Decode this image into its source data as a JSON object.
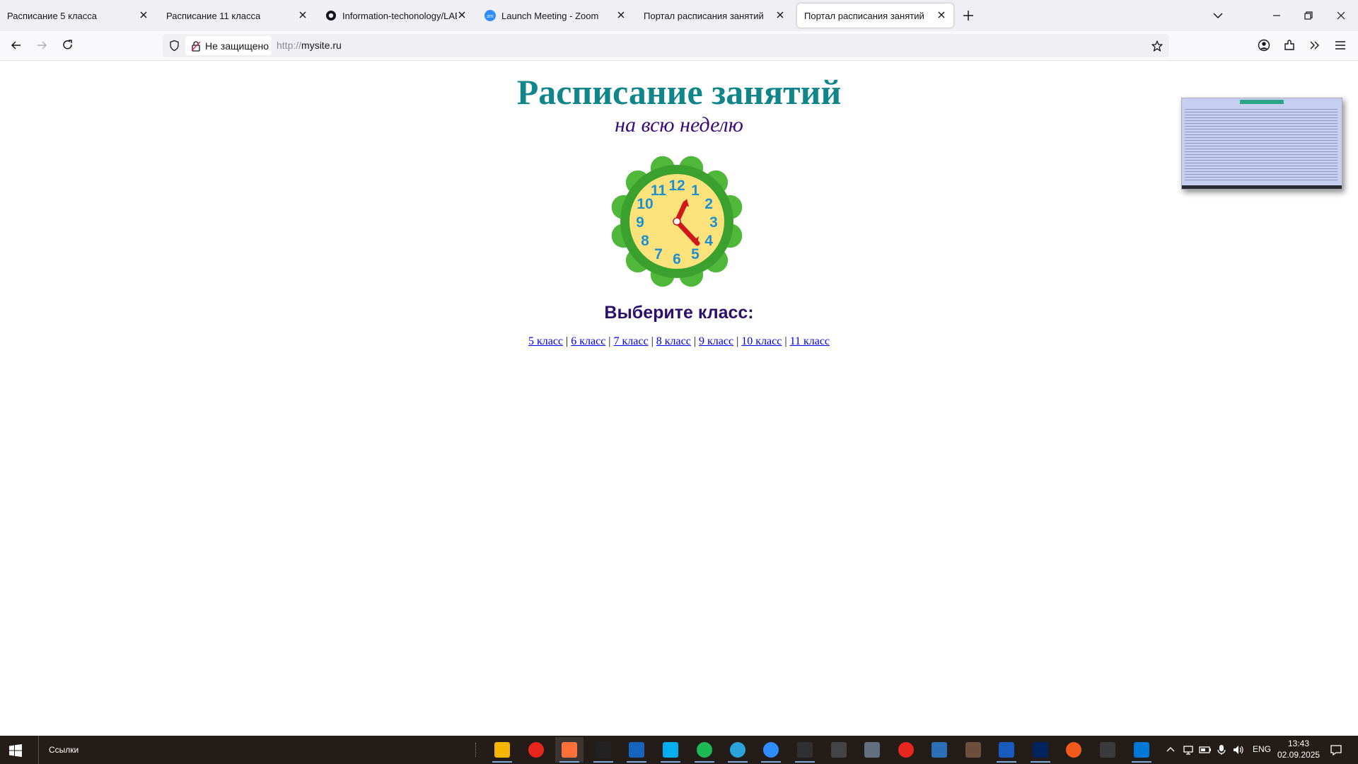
{
  "browser": {
    "tabs": [
      {
        "title": "Расписание 5 класса",
        "active": false,
        "favicon": "none"
      },
      {
        "title": "Расписание 11 класса",
        "active": false,
        "favicon": "none"
      },
      {
        "title": "Information-techonology/LAB1",
        "active": false,
        "favicon": "github-icon"
      },
      {
        "title": "Launch Meeting - Zoom",
        "active": false,
        "favicon": "zoom-icon"
      },
      {
        "title": "Портал расписания занятий",
        "active": false,
        "favicon": "none"
      },
      {
        "title": "Портал расписания занятий",
        "active": true,
        "favicon": "none"
      }
    ],
    "security_label": "Не защищено",
    "url_protocol": "http://",
    "url_host": "mysite.ru"
  },
  "page": {
    "title": "Расписание занятий",
    "subtitle": "на всю неделю",
    "choose_label": "Выберите класс:",
    "class_links": [
      "5 класс",
      "6 класс",
      "7 класс",
      "8 класс",
      "9 класс",
      "10 класс",
      "11 класс"
    ],
    "clock_numbers": [
      "12",
      "1",
      "2",
      "3",
      "4",
      "5",
      "6",
      "7",
      "8",
      "9",
      "10",
      "11"
    ]
  },
  "taskbar": {
    "links_label": "Ссылки",
    "apps": [
      "file-explorer-icon",
      "yandex-icon",
      "firefox-icon",
      "intellij-icon",
      "libreoffice-icon",
      "skype-icon",
      "spotify-icon",
      "telegram-icon",
      "zoom-icon",
      "obs-icon",
      "tool-icon",
      "image-viewer-icon",
      "yandex-browser-icon",
      "cloud-icon",
      "screenshot-icon",
      "word-icon",
      "powershell-icon",
      "app-icon",
      "network-tool-icon",
      "vscode-icon"
    ],
    "language": "ENG",
    "time": "13:43",
    "date": "02.09.2025"
  },
  "colors": {
    "title": "#11868a",
    "subtitle": "#3b0b7a",
    "choose": "#2c0f6b",
    "link": "#0000ee",
    "clock_ring": "#3aa02e",
    "clock_face": "#fbe27a",
    "clock_hands": "#d0171c",
    "clock_digits": "#1e8fd0"
  }
}
